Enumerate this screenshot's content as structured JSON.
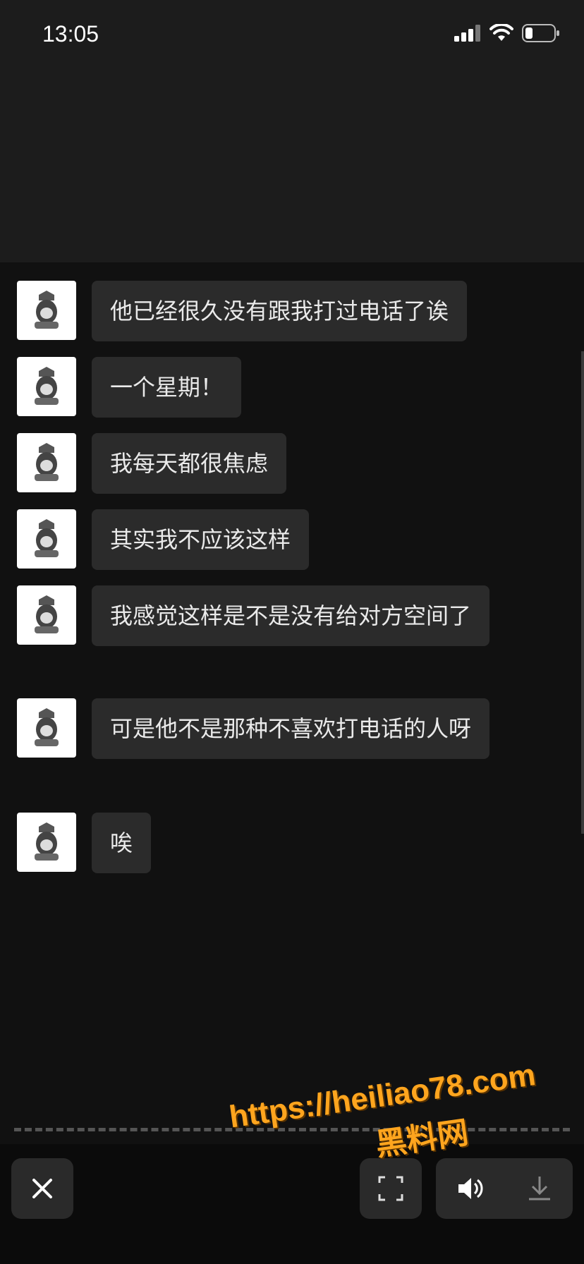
{
  "status_bar": {
    "time": "13:05"
  },
  "messages": [
    {
      "text": "他已经很久没有跟我打过电话了诶"
    },
    {
      "text": "一个星期！"
    },
    {
      "text": "我每天都很焦虑"
    },
    {
      "text": "其实我不应该这样"
    },
    {
      "text": "我感觉这样是不是没有给对方空间了"
    },
    {
      "text": "可是他不是那种不喜欢打电话的人呀"
    },
    {
      "text": "唉"
    }
  ],
  "watermark": {
    "url": "https://heiliao78.com",
    "name": "黑料网"
  },
  "icons": {
    "close": "close-icon",
    "scan": "scan-icon",
    "speaker": "speaker-icon",
    "download": "download-icon",
    "signal": "signal-icon",
    "wifi": "wifi-icon",
    "battery": "battery-icon"
  },
  "colors": {
    "bubble": "#2b2b2b",
    "watermark": "#ffa51e"
  }
}
